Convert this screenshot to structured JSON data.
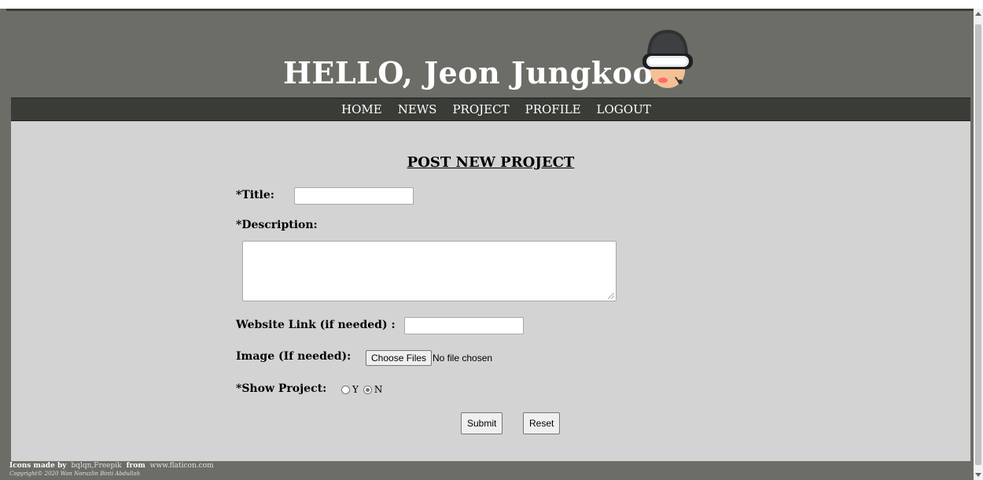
{
  "header": {
    "title": "HELLO, Jeon Jungkook",
    "avatar_icon": "pilot-avatar-icon"
  },
  "nav": {
    "items": [
      {
        "label": "HOME"
      },
      {
        "label": "NEWS"
      },
      {
        "label": "PROJECT"
      },
      {
        "label": "PROFILE"
      },
      {
        "label": "LOGOUT"
      }
    ]
  },
  "form": {
    "heading": "POST NEW PROJECT",
    "title_label": "*Title:",
    "title_value": "",
    "description_label": "*Description:",
    "description_value": "",
    "website_label": "Website Link (if needed) :",
    "website_value": "",
    "image_label": "Image (If needed):",
    "choose_files_label": "Choose Files",
    "file_status": "No file chosen",
    "show_label": "*Show Project:",
    "show_options": [
      {
        "label": "Y",
        "selected": false
      },
      {
        "label": "N",
        "selected": true
      }
    ],
    "submit_label": "Submit",
    "reset_label": "Reset"
  },
  "footer": {
    "icons_made_by": "Icons made by",
    "authors": "bqlqn,Freepik",
    "from": "from",
    "site": "www.flaticon.com",
    "copyright": "Copyright© 2020 Wan Noruzlin Binti Abdullah"
  },
  "colors": {
    "header_bg": "#6b6d66",
    "nav_bg": "#3a3c37",
    "content_bg": "#d3d3d3"
  }
}
